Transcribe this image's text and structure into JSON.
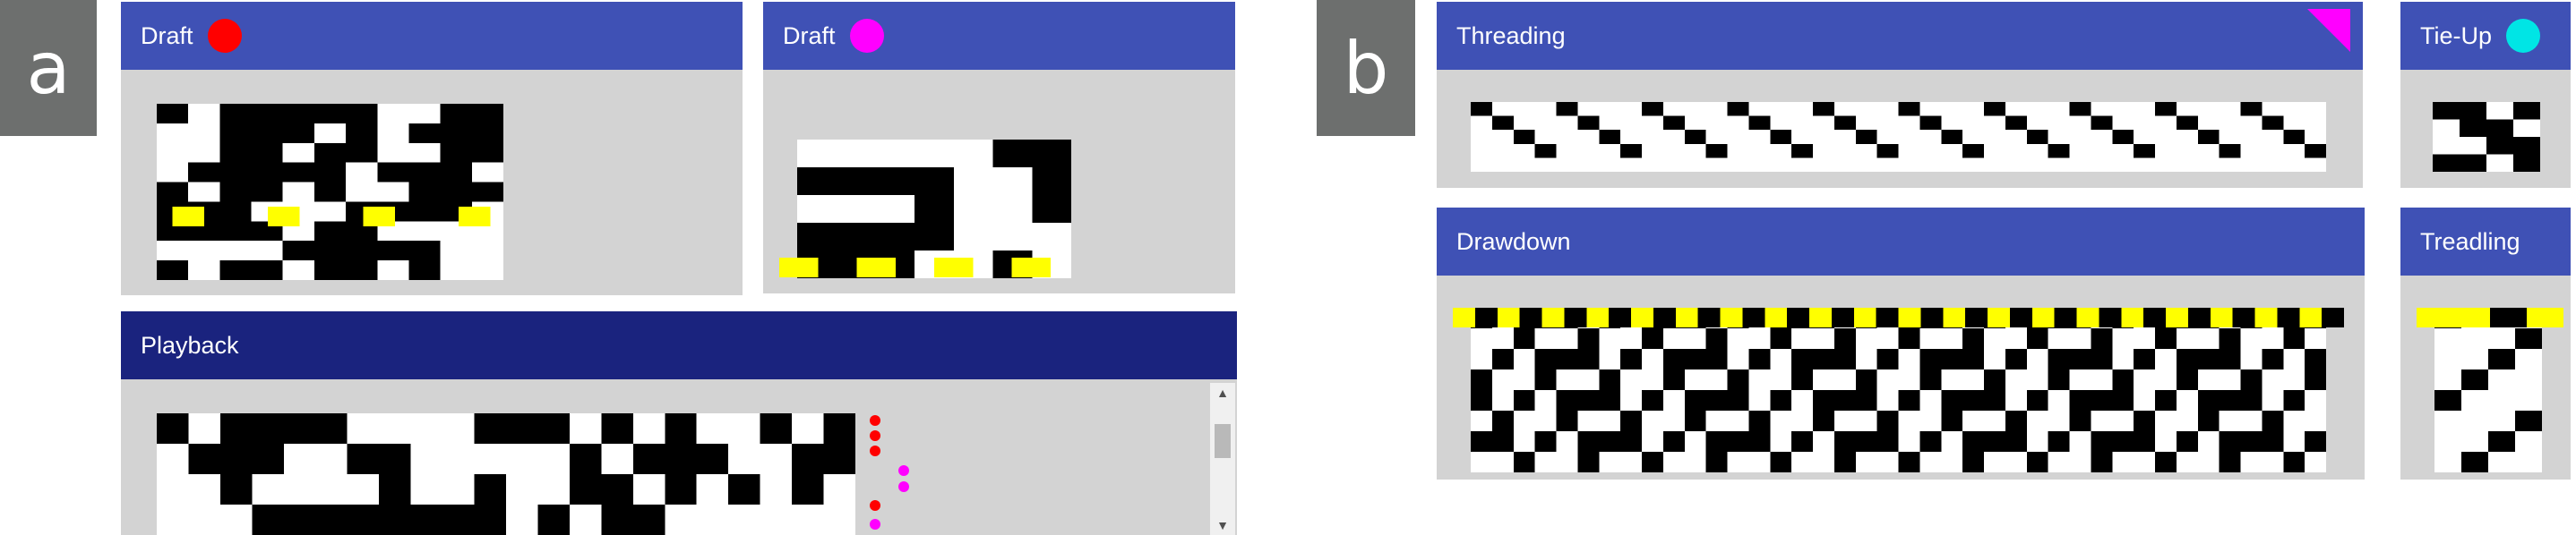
{
  "labels": {
    "a": "a",
    "b": "b"
  },
  "draft1": {
    "title": "Draft",
    "dot_color": "#ff0000"
  },
  "draft2": {
    "title": "Draft",
    "dot_color": "#ff00ff"
  },
  "playback": {
    "title": "Playback"
  },
  "threading": {
    "title": "Threading",
    "corner_color": "#ff00ff"
  },
  "tieup": {
    "title": "Tie-Up",
    "dot_color": "#00e5e5"
  },
  "drawdown": {
    "title": "Drawdown"
  },
  "treadling": {
    "title": "Treadling"
  },
  "colors": {
    "highlight_row": "#ffff00",
    "panel_bg": "#d3d3d3",
    "header": "#3f51b5",
    "header_dark": "#1a237e"
  }
}
